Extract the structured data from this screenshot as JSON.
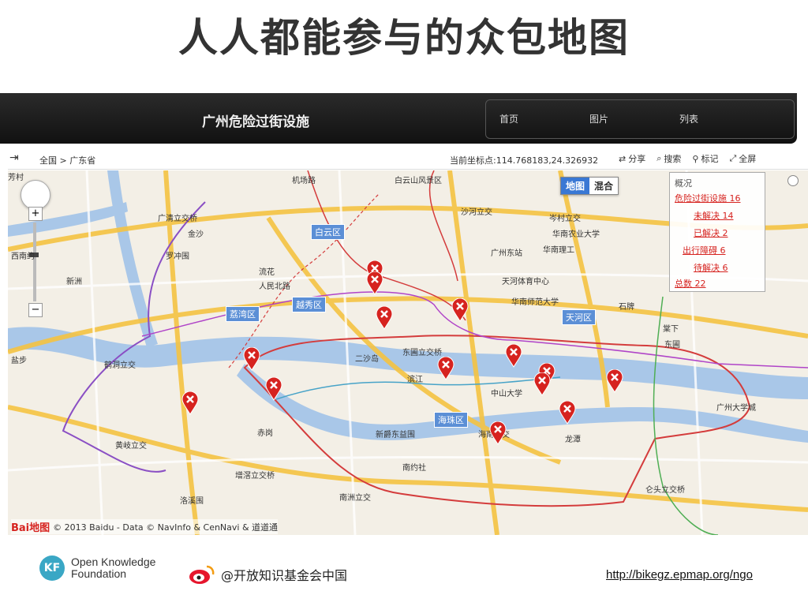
{
  "slide": {
    "title": "人人都能参与的众包地图",
    "url": "http://bikegz.epmap.org/ngo",
    "weibo_handle": "@开放知识基金会中国",
    "org_line1": "Open Knowledge",
    "org_line2": "Foundation",
    "org_logo_text": "KF"
  },
  "site": {
    "title": "广州危险过街设施",
    "nav": [
      "首页",
      "图片",
      "列表"
    ]
  },
  "toolbar": {
    "collapse_icon": "collapse-arrow-icon",
    "breadcrumb": "全国 > 广东省",
    "coords": "当前坐标点:114.768183,24.326932",
    "tools": [
      {
        "label": "分享",
        "icon": "share-icon",
        "glyph": "⇄"
      },
      {
        "label": "搜索",
        "icon": "search-icon",
        "glyph": "⌕"
      },
      {
        "label": "标记",
        "icon": "pin-icon",
        "glyph": "⚲"
      },
      {
        "label": "全屏",
        "icon": "fullscreen-icon",
        "glyph": "⤢"
      }
    ]
  },
  "map": {
    "type_active": "地图",
    "type_inactive": "混合",
    "copyright": "© 2013 Baidu - Data © NavInfo & CenNavi & 道道通",
    "baidu_logo": "Bai地图",
    "districts": [
      "白云区",
      "越秀区",
      "荔湾区",
      "天河区",
      "海珠区"
    ],
    "places": [
      "机场路",
      "白云山风景区",
      "广清立交桥",
      "金沙",
      "罗冲围",
      "流花",
      "人民北路",
      "广州东站",
      "沙河立交",
      "岑村立交",
      "华南农业大学",
      "华南理工",
      "天河体育中心",
      "华南师范大学",
      "石牌",
      "棠下",
      "东圃",
      "东圃立交桥",
      "二沙岛",
      "滨江",
      "中山大学",
      "赤岗",
      "鹤洞立交",
      "黄岐立交",
      "增滘立交桥",
      "新爵东益围",
      "南约社",
      "南洲立交",
      "洛溪围",
      "海南立交",
      "龙潭",
      "仑头立交桥",
      "广州大学城",
      "新洲",
      "西南约",
      "盐步",
      "芳村"
    ],
    "marker_count": 14
  },
  "overview": {
    "title": "概况",
    "items": [
      "危险过街设施 16",
      "未解决 14",
      "已解决 2",
      "出行障碍 6",
      "待解决 6",
      "总数 22"
    ]
  },
  "colors": {
    "nav_bg": "#1a1a1a",
    "marker": "#d6231f",
    "district": "#5b8fd6",
    "map_type_active": "#3a78d4",
    "river": "#a9c7e8",
    "road_major": "#f5c342",
    "road_minor": "#ffffff",
    "boundary_red": "#d43c3c",
    "boundary_purple": "#8a4fc4",
    "okf": "#3aa7c5"
  }
}
